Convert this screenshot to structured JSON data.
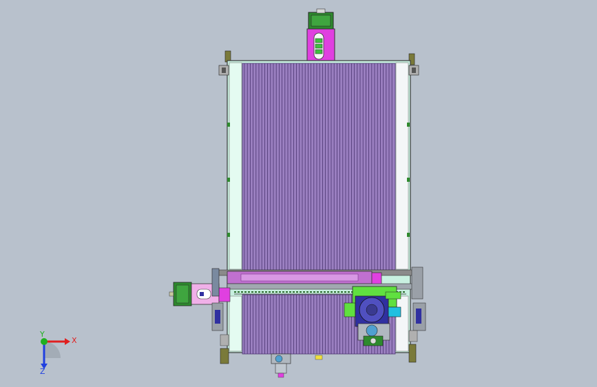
{
  "viewport": {
    "background": "#b8c1cc"
  },
  "triad": {
    "x_label": "X",
    "y_label": "Y",
    "z_label": "Z",
    "x_color": "#e02020",
    "y_color": "#20b020",
    "z_color": "#2040e0"
  },
  "colors": {
    "frame": "#c8f0e0",
    "frame_outline": "#3a3a3a",
    "roller_fill": "#9a7fc0",
    "roller_line": "#4a3470",
    "motor_magenta": "#e040e0",
    "motor_green": "#2e8a2e",
    "motor_pink": "#f0b0e8",
    "carriage_green": "#60e040",
    "carriage_blue": "#3030a0",
    "accent_cyan": "#20c0e0",
    "rail_white": "#f4f6f8",
    "bar_purple": "#c070d0",
    "yellow": "#f0e040"
  }
}
